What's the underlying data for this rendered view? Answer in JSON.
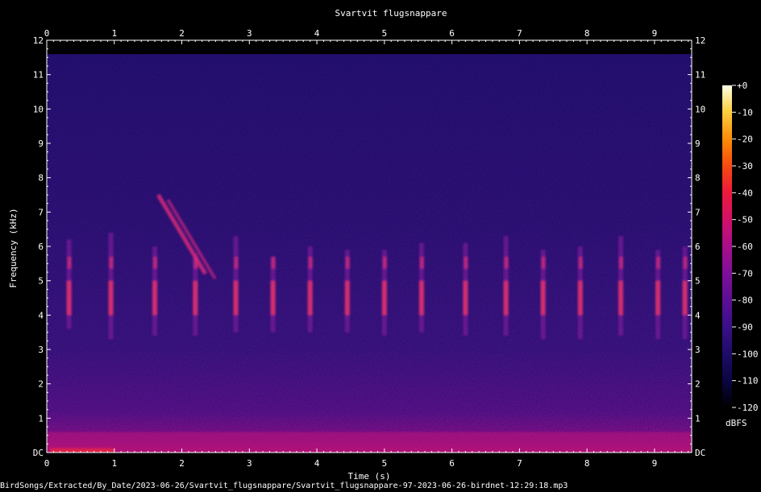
{
  "chart_data": {
    "type": "heatmap",
    "title": "Svartvit flugsnappare",
    "xlabel": "Time (s)",
    "ylabel": "Frequency (kHz)",
    "xlim": [
      0,
      9.55
    ],
    "ylim": [
      0,
      12
    ],
    "x_ticks": [
      "0",
      "1",
      "2",
      "3",
      "4",
      "5",
      "6",
      "7",
      "8",
      "9"
    ],
    "y_ticks": [
      "DC",
      "1",
      "2",
      "3",
      "4",
      "5",
      "6",
      "7",
      "8",
      "9",
      "10",
      "11",
      "12"
    ],
    "colorbar": {
      "label": "dBFS",
      "range": [
        -120,
        0
      ],
      "ticks": [
        "+0",
        "-10",
        "-20",
        "-30",
        "-40",
        "-50",
        "-60",
        "-70",
        "-80",
        "-90",
        "-100",
        "-110",
        "-120"
      ]
    },
    "calls": [
      {
        "t": 0.33,
        "f_low": 3.6,
        "f_high": 6.2
      },
      {
        "t": 0.95,
        "f_low": 3.3,
        "f_high": 6.4
      },
      {
        "t": 1.6,
        "f_low": 3.4,
        "f_high": 6.0
      },
      {
        "t": 2.2,
        "f_low": 3.4,
        "f_high": 5.8
      },
      {
        "t": 2.8,
        "f_low": 3.5,
        "f_high": 6.3
      },
      {
        "t": 3.35,
        "f_low": 3.5,
        "f_high": 5.7
      },
      {
        "t": 3.9,
        "f_low": 3.5,
        "f_high": 6.0
      },
      {
        "t": 4.45,
        "f_low": 3.5,
        "f_high": 5.9
      },
      {
        "t": 5.0,
        "f_low": 3.4,
        "f_high": 5.9
      },
      {
        "t": 5.55,
        "f_low": 3.5,
        "f_high": 6.1
      },
      {
        "t": 6.2,
        "f_low": 3.4,
        "f_high": 6.1
      },
      {
        "t": 6.8,
        "f_low": 3.4,
        "f_high": 6.3
      },
      {
        "t": 7.35,
        "f_low": 3.3,
        "f_high": 5.9
      },
      {
        "t": 7.9,
        "f_low": 3.3,
        "f_high": 6.0
      },
      {
        "t": 8.5,
        "f_low": 3.4,
        "f_high": 6.3
      },
      {
        "t": 9.05,
        "f_low": 3.3,
        "f_high": 5.9
      },
      {
        "t": 9.45,
        "f_low": 3.3,
        "f_high": 6.0
      }
    ],
    "sweeps": [
      {
        "t_start": 1.65,
        "t_end": 2.35,
        "f_start": 7.5,
        "f_end": 5.2
      }
    ]
  },
  "file_path": "BirdSongs/Extracted/By_Date/2023-06-26/Svartvit_flugsnappare/Svartvit_flugsnappare-97-2023-06-26-birdnet-12:29:18.mp3"
}
